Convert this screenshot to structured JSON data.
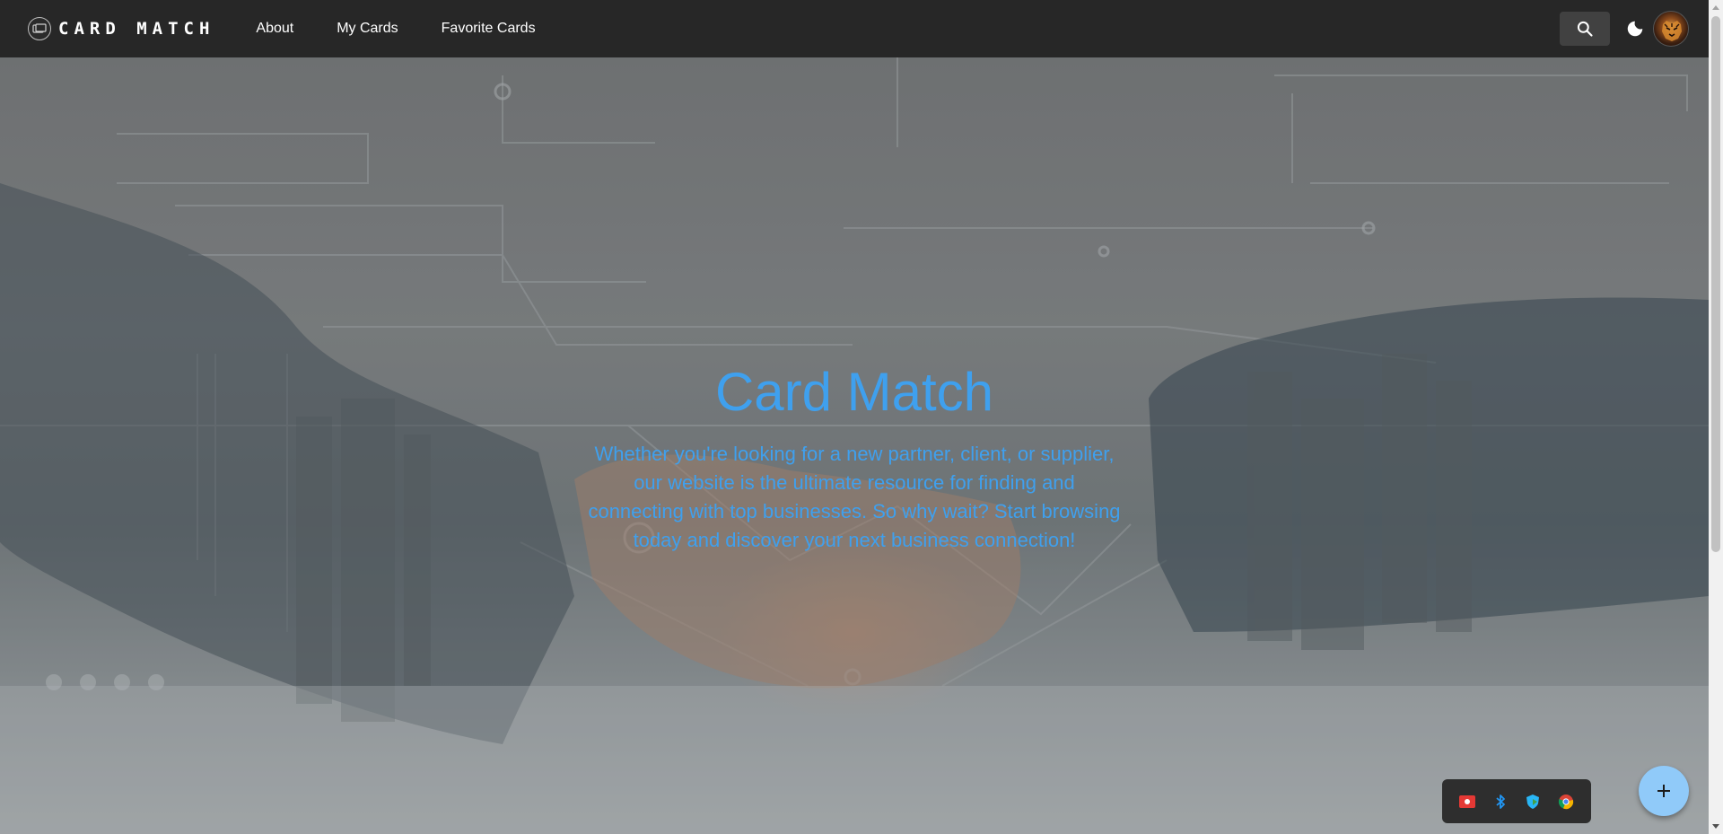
{
  "brand": {
    "name": "CARD MATCH",
    "logo_icon": "card-logo-icon"
  },
  "nav": {
    "links": [
      {
        "label": "About"
      },
      {
        "label": "My Cards"
      },
      {
        "label": "Favorite Cards"
      }
    ]
  },
  "actions": {
    "search_icon": "search-icon",
    "theme_icon": "moon-icon",
    "avatar_icon": "tiger-avatar"
  },
  "hero": {
    "title": "Card Match",
    "text": "Whether you're looking for a new partner, client, or supplier, our website is the ultimate resource for finding and connecting with top businesses. So why wait? Start browsing today and discover your next business connection!"
  },
  "fab": {
    "icon": "plus-icon"
  },
  "tray": {
    "icons": [
      "screen-record-icon",
      "bluetooth-icon",
      "security-shield-icon",
      "chrome-icon"
    ]
  },
  "colors": {
    "navbar": "#272727",
    "accent": "#3fa0ee",
    "fab": "#90caf9"
  }
}
